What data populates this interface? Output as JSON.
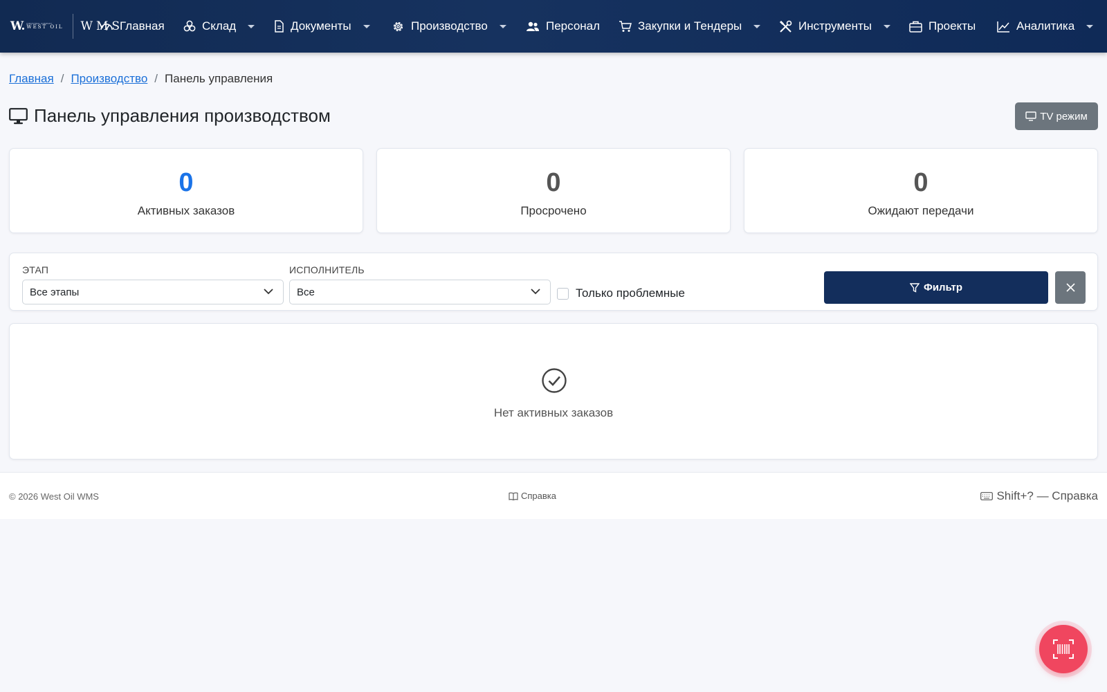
{
  "brand": {
    "logo_letter": "W.",
    "logo_tagline": "INDUSTRIAL COMPANY",
    "logo_name": "WEST OIL",
    "product": "WMS"
  },
  "nav": {
    "items": [
      {
        "label": "Главная",
        "icon": "speedometer-icon",
        "dropdown": false
      },
      {
        "label": "Склад",
        "icon": "boxes-icon",
        "dropdown": true
      },
      {
        "label": "Документы",
        "icon": "document-icon",
        "dropdown": true
      },
      {
        "label": "Производство",
        "icon": "gear-icon",
        "dropdown": true
      },
      {
        "label": "Персонал",
        "icon": "people-icon",
        "dropdown": false
      },
      {
        "label": "Закупки и Тендеры",
        "icon": "cart-icon",
        "dropdown": true
      },
      {
        "label": "Инструменты",
        "icon": "tools-icon",
        "dropdown": true
      },
      {
        "label": "Проекты",
        "icon": "briefcase-icon",
        "dropdown": false
      },
      {
        "label": "Аналитика",
        "icon": "chart-line-icon",
        "dropdown": true
      }
    ]
  },
  "breadcrumb": {
    "home": "Главная",
    "section": "Производство",
    "current": "Панель управления",
    "separator": "/"
  },
  "page": {
    "title": "Панель управления производством",
    "tv_button": "TV режим"
  },
  "stats": [
    {
      "value": "0",
      "label": "Активных заказов",
      "color": "#1a73e8"
    },
    {
      "value": "0",
      "label": "Просрочено",
      "color": "#555555"
    },
    {
      "value": "0",
      "label": "Ожидают передачи",
      "color": "#555555"
    }
  ],
  "filters": {
    "stage_label": "ЭТАП",
    "stage_value": "Все этапы",
    "executor_label": "ИСПОЛНИТЕЛЬ",
    "executor_value": "Все",
    "problems_only_label": "Только проблемные",
    "problems_only_checked": false,
    "filter_button": "Фильтр"
  },
  "empty_state": {
    "message": "Нет активных заказов"
  },
  "footer": {
    "copyright": "© 2026 West Oil WMS",
    "help": "Справка",
    "shortcut": "Shift+? — Справка"
  },
  "colors": {
    "navbar": "#132e5c",
    "primary_button": "#132e5c",
    "secondary_button": "#6c757d",
    "link": "#1a6fd8",
    "fab": "#f0465f",
    "active_orders_value": "#1a73e8"
  }
}
